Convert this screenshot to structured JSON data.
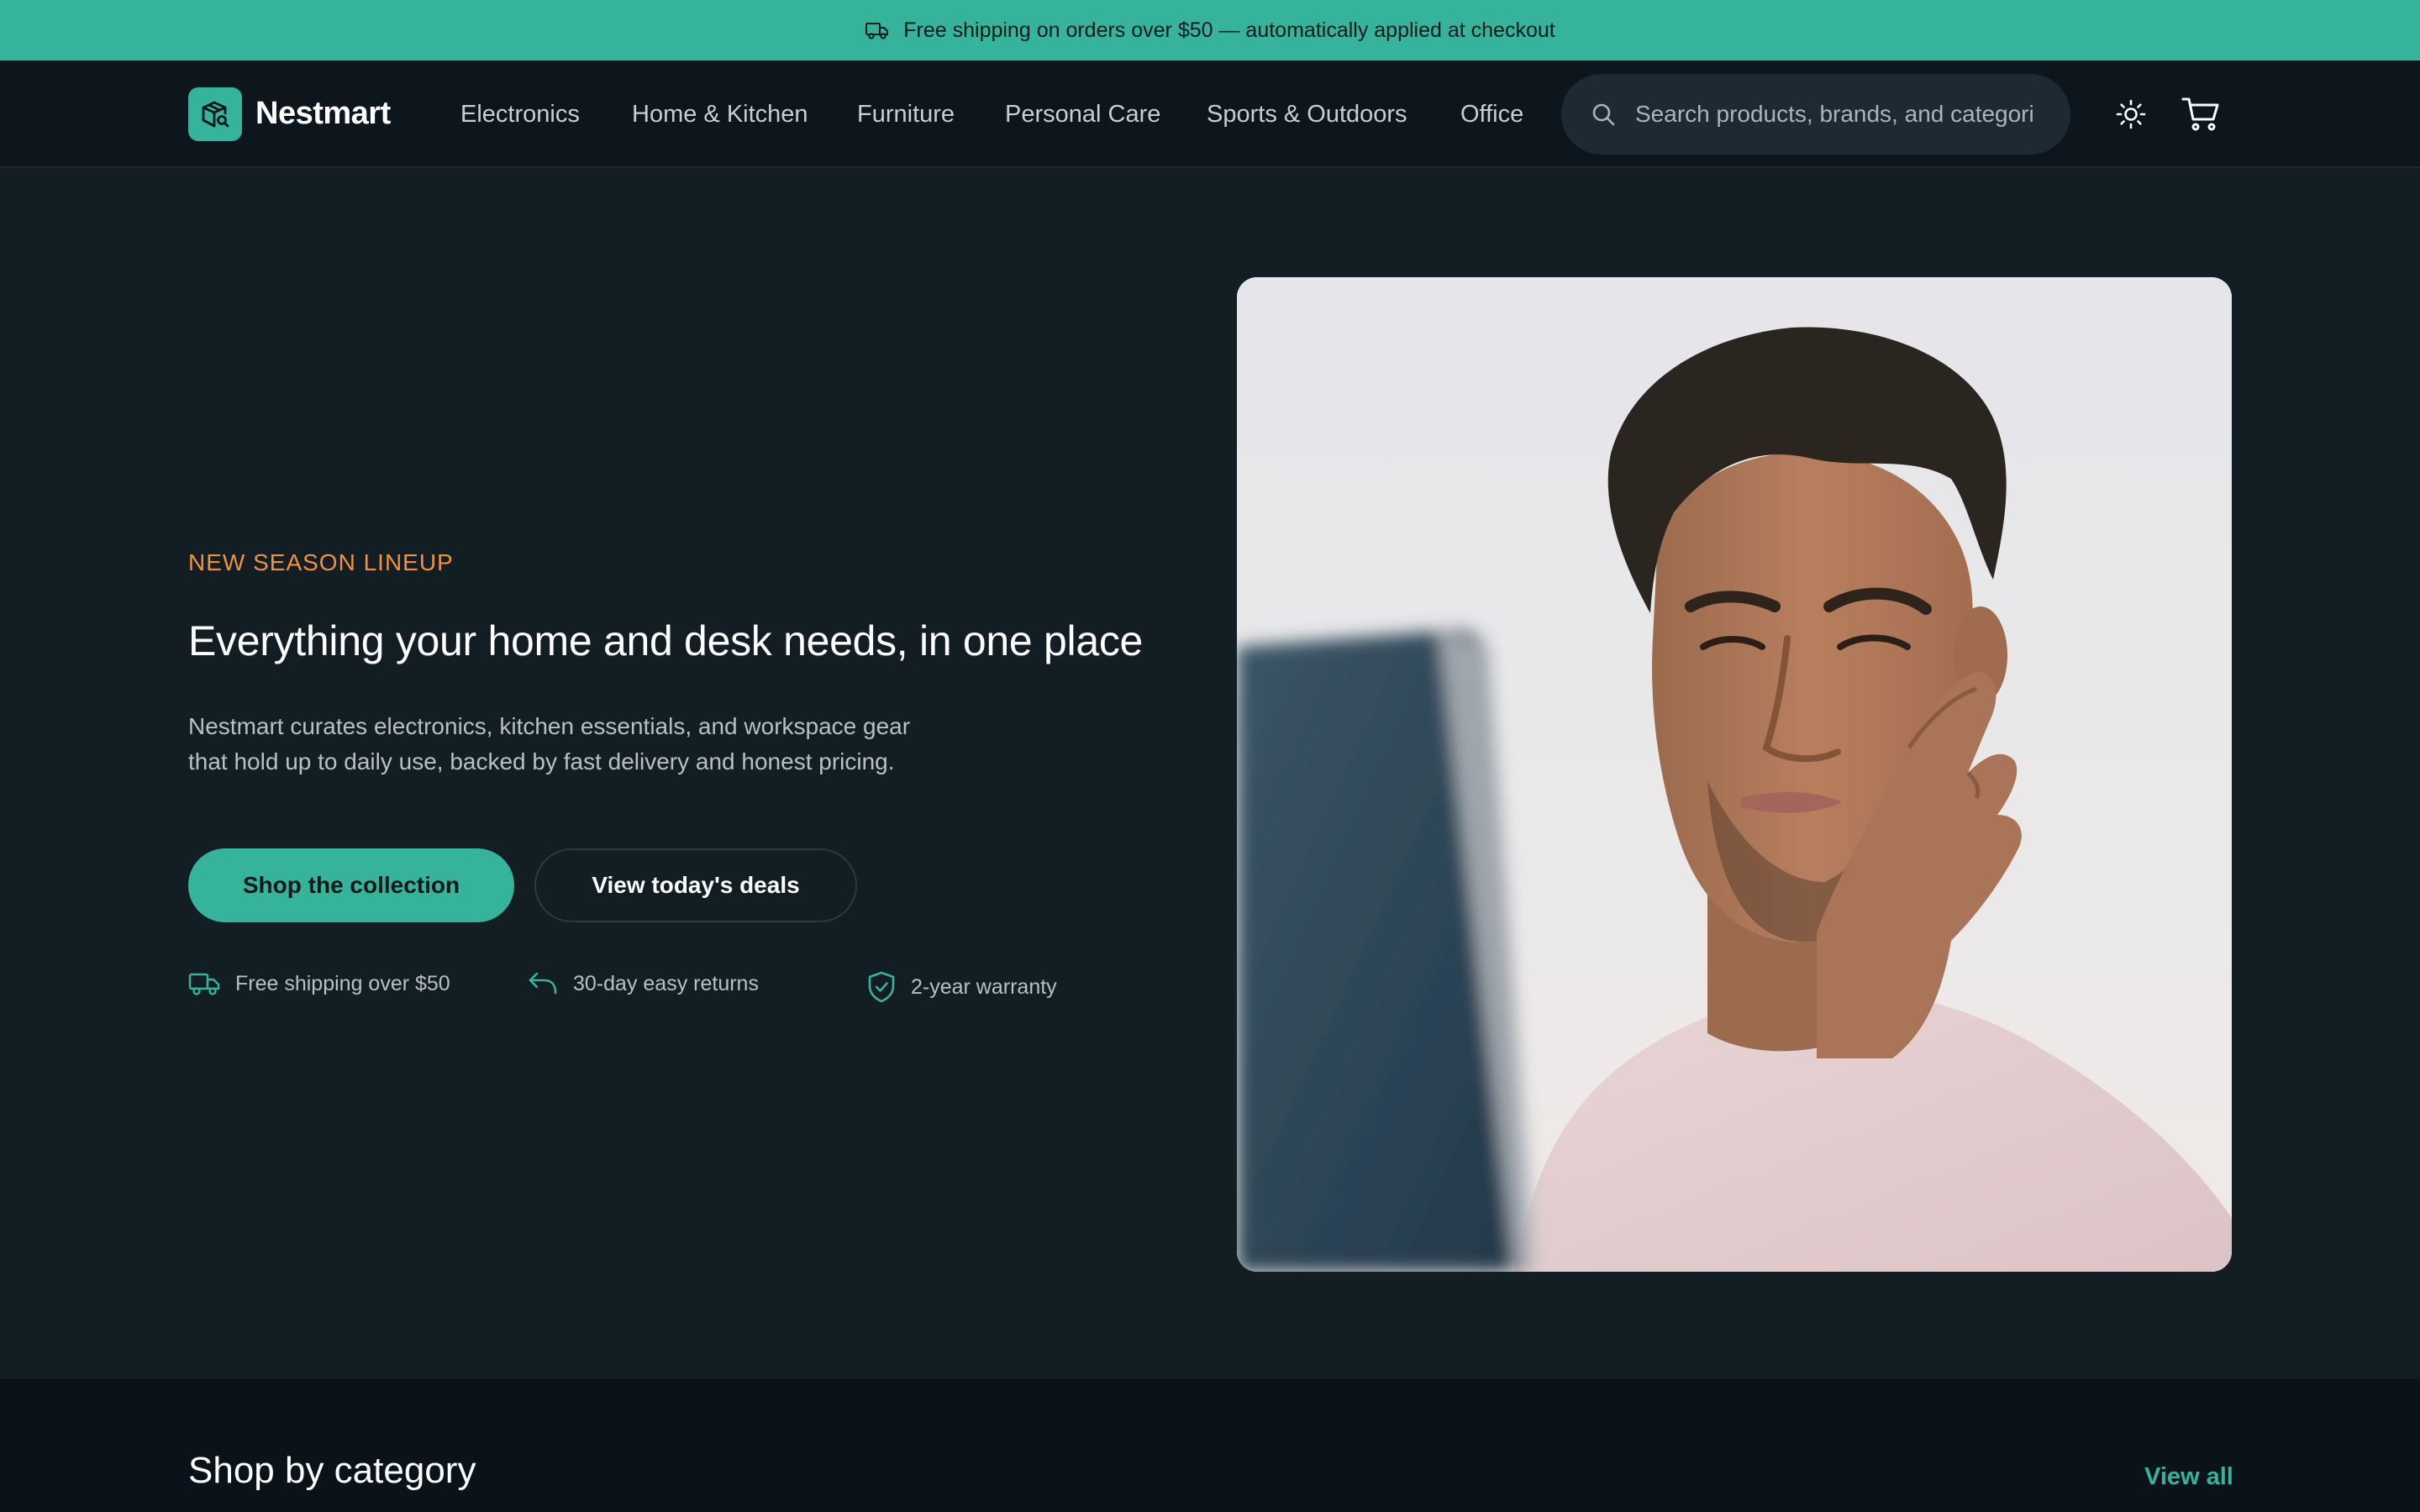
{
  "announcement": {
    "text": "Free shipping on orders over $50 — automatically applied at checkout",
    "icon": "truck-icon"
  },
  "header": {
    "brand": "Nestmart",
    "logo_icon": "package-search-icon",
    "nav": [
      "Electronics",
      "Home & Kitchen",
      "Furniture",
      "Personal Care",
      "Sports & Outdoors",
      "Office"
    ],
    "search": {
      "placeholder": "Search products, brands, and categories",
      "icon": "search-icon"
    },
    "theme_toggle_icon": "sun-icon",
    "cart_icon": "cart-icon"
  },
  "hero": {
    "eyebrow": "NEW SEASON LINEUP",
    "title": "Everything your home and desk needs, in one place",
    "description": "Nestmart curates electronics, kitchen essentials, and workspace gear that hold up to daily use, backed by fast delivery and honest pricing.",
    "primary_cta": "Shop the collection",
    "secondary_cta": "View today's deals",
    "perks": [
      {
        "icon": "truck-icon",
        "label": "Free shipping over $50"
      },
      {
        "icon": "return-arrow-icon",
        "label": "30-day easy returns"
      },
      {
        "icon": "shield-check-icon",
        "label": "2-year warranty"
      }
    ],
    "image_alt": "man-thinking-at-laptop-photo"
  },
  "categories": {
    "title": "Shop by category",
    "view_all": "View all"
  },
  "colors": {
    "accent": "#35b39b",
    "eyebrow": "#f0923d",
    "background": "#131d24",
    "header": "#0d161d"
  }
}
